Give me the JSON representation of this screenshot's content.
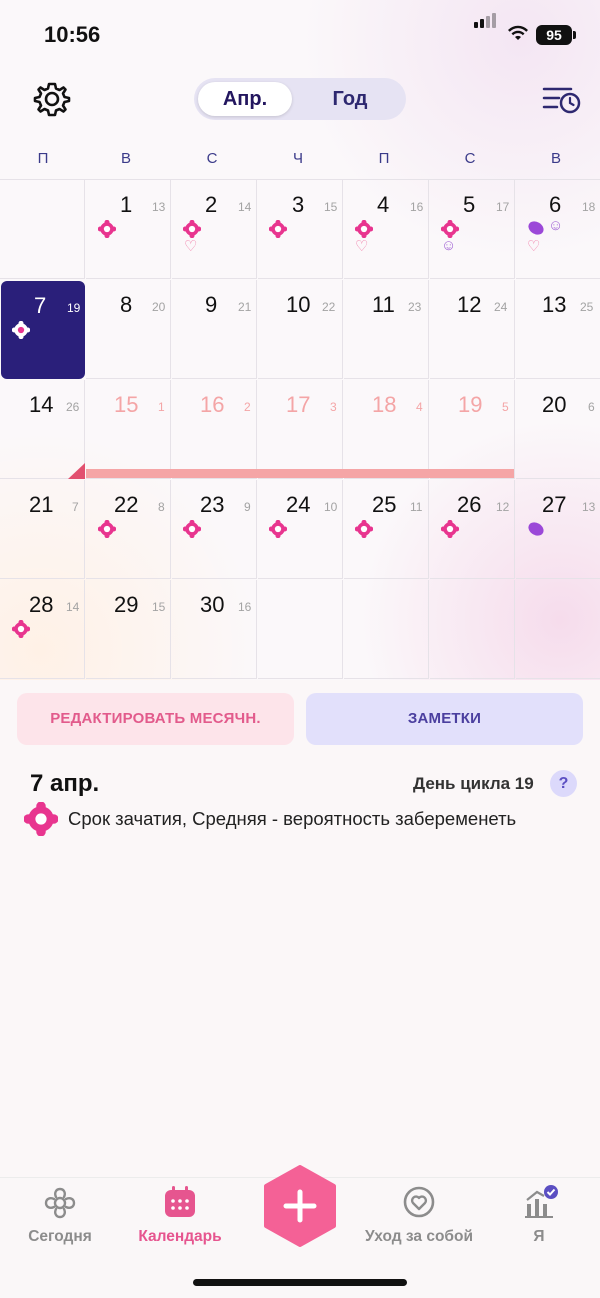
{
  "status_bar": {
    "time": "10:56",
    "battery": "95"
  },
  "header": {
    "segment_active": "Апр.",
    "segment_other": "Год"
  },
  "weekdays": [
    "П",
    "В",
    "С",
    "Ч",
    "П",
    "С",
    "В"
  ],
  "calendar": {
    "selected_day": "7",
    "rows": [
      [
        {
          "day": "",
          "cycle": ""
        },
        {
          "day": "1",
          "cycle": "13"
        },
        {
          "day": "2",
          "cycle": "14"
        },
        {
          "day": "3",
          "cycle": "15"
        },
        {
          "day": "4",
          "cycle": "16"
        },
        {
          "day": "5",
          "cycle": "17"
        },
        {
          "day": "6",
          "cycle": "18"
        }
      ],
      [
        {
          "day": "7",
          "cycle": "19"
        },
        {
          "day": "8",
          "cycle": "20"
        },
        {
          "day": "9",
          "cycle": "21"
        },
        {
          "day": "10",
          "cycle": "22"
        },
        {
          "day": "11",
          "cycle": "23"
        },
        {
          "day": "12",
          "cycle": "24"
        },
        {
          "day": "13",
          "cycle": "25"
        }
      ],
      [
        {
          "day": "14",
          "cycle": "26"
        },
        {
          "day": "15",
          "cycle": "1"
        },
        {
          "day": "16",
          "cycle": "2"
        },
        {
          "day": "17",
          "cycle": "3"
        },
        {
          "day": "18",
          "cycle": "4"
        },
        {
          "day": "19",
          "cycle": "5"
        },
        {
          "day": "20",
          "cycle": "6"
        }
      ],
      [
        {
          "day": "21",
          "cycle": "7"
        },
        {
          "day": "22",
          "cycle": "8"
        },
        {
          "day": "23",
          "cycle": "9"
        },
        {
          "day": "24",
          "cycle": "10"
        },
        {
          "day": "25",
          "cycle": "11"
        },
        {
          "day": "26",
          "cycle": "12"
        },
        {
          "day": "27",
          "cycle": "13"
        }
      ],
      [
        {
          "day": "28",
          "cycle": "14"
        },
        {
          "day": "29",
          "cycle": "15"
        },
        {
          "day": "30",
          "cycle": "16"
        },
        {
          "day": "",
          "cycle": ""
        },
        {
          "day": "",
          "cycle": ""
        },
        {
          "day": "",
          "cycle": ""
        },
        {
          "day": "",
          "cycle": ""
        }
      ]
    ],
    "colors": {
      "selected": "#2a1f7a",
      "period": "#f5a5a6",
      "fertile": "#e8358f"
    }
  },
  "actions": {
    "edit_period": "РЕДАКТИРОВАТЬ МЕСЯЧН.",
    "notes": "ЗАМЕТКИ"
  },
  "day_info": {
    "date": "7 апр.",
    "cycle_day": "День цикла 19",
    "help": "?",
    "line": "Срок зачатия, Средняя - вероятность забеременеть"
  },
  "tabs": [
    {
      "label": "Сегодня",
      "icon": "flower-outline-icon"
    },
    {
      "label": "Календарь",
      "icon": "calendar-icon"
    },
    {
      "label": "Уход за собой",
      "icon": "heart-circle-icon"
    },
    {
      "label": "Я",
      "icon": "chart-badge-icon"
    }
  ]
}
